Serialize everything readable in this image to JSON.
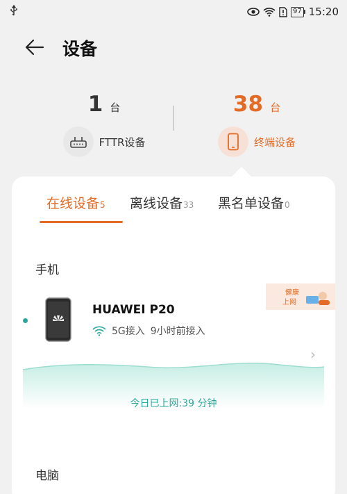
{
  "status_bar": {
    "time": "15:20",
    "battery": "97"
  },
  "header": {
    "title": "设备"
  },
  "summary": {
    "fttr": {
      "count": "1",
      "unit": "台",
      "label": "FTTR设备"
    },
    "terminal": {
      "count": "38",
      "unit": "台",
      "label": "终端设备"
    }
  },
  "tabs": [
    {
      "label": "在线设备",
      "count": "5",
      "active": true
    },
    {
      "label": "离线设备",
      "count": "33",
      "active": false
    },
    {
      "label": "黑名单设备",
      "count": "0",
      "active": false
    }
  ],
  "sections": {
    "phone": "手机",
    "computer": "电脑"
  },
  "device": {
    "name": "HUAWEI P20",
    "band": "5G接入",
    "since": "9小时前接入",
    "online_time": "今日已上网:39 分钟",
    "badge": "健康上网"
  },
  "colors": {
    "accent": "#e46b25",
    "teal": "#2aa89a"
  }
}
